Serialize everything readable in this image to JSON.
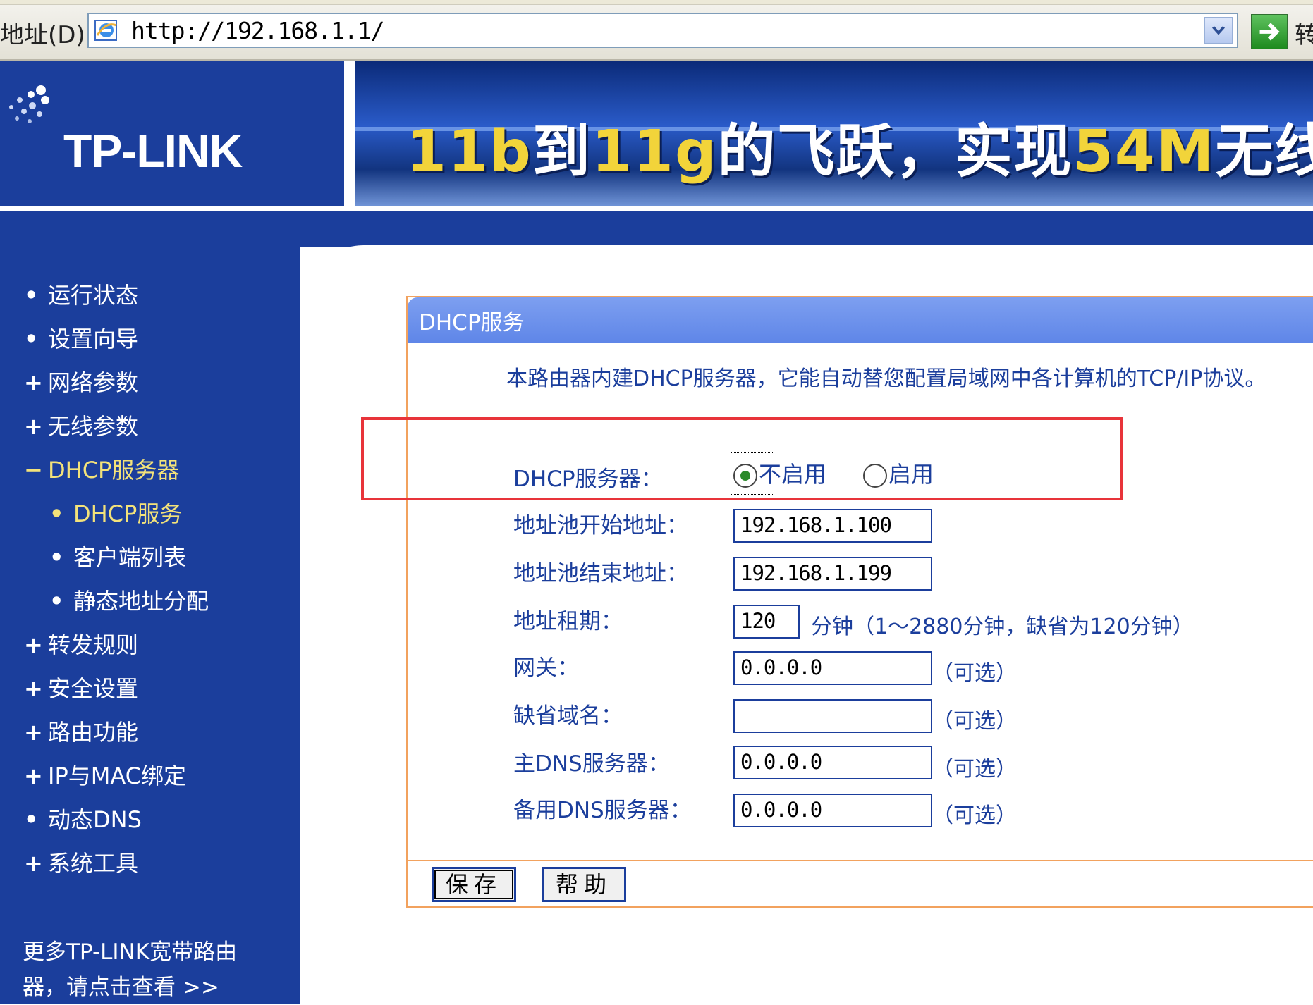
{
  "browser": {
    "address_label": "地址(D)",
    "url": "http://192.168.1.1/",
    "go_label": "转"
  },
  "banner": {
    "logo": "TP-LINK",
    "slogan_parts": [
      "11b",
      "到",
      "11g",
      "的飞跃，实现",
      "54M",
      "无线高"
    ]
  },
  "sidebar": {
    "items": [
      {
        "mark": "•",
        "label": "运行状态"
      },
      {
        "mark": "•",
        "label": "设置向导"
      },
      {
        "mark": "+",
        "label": "网络参数"
      },
      {
        "mark": "+",
        "label": "无线参数"
      },
      {
        "mark": "−",
        "label": "DHCP服务器"
      },
      {
        "mark": "•",
        "label": "DHCP服务"
      },
      {
        "mark": "•",
        "label": "客户端列表"
      },
      {
        "mark": "•",
        "label": "静态地址分配"
      },
      {
        "mark": "+",
        "label": "转发规则"
      },
      {
        "mark": "+",
        "label": "安全设置"
      },
      {
        "mark": "+",
        "label": "路由功能"
      },
      {
        "mark": "+",
        "label": "IP与MAC绑定"
      },
      {
        "mark": "•",
        "label": "动态DNS"
      },
      {
        "mark": "+",
        "label": "系统工具"
      }
    ],
    "more_link": "更多TP-LINK宽带路由器，请点击查看 >>"
  },
  "panel": {
    "title": "DHCP服务",
    "description": "本路由器内建DHCP服务器，它能自动替您配置局域网中各计算机的TCP/IP协议。",
    "dhcp_server_label": "DHCP服务器：",
    "radio_disable": "不启用",
    "radio_enable": "启用",
    "radio_selected": "不启用",
    "pool_start_label": "地址池开始地址：",
    "pool_start_value": "192.168.1.100",
    "pool_end_label": "地址池结束地址：",
    "pool_end_value": "192.168.1.199",
    "lease_label": "地址租期：",
    "lease_value": "120",
    "lease_note": "分钟（1～2880分钟，缺省为120分钟）",
    "gateway_label": "网关：",
    "gateway_value": "0.0.0.0",
    "domain_label": "缺省域名：",
    "domain_value": "",
    "dns1_label": "主DNS服务器：",
    "dns1_value": "0.0.0.0",
    "dns2_label": "备用DNS服务器：",
    "dns2_value": "0.0.0.0",
    "optional_note": "（可选）",
    "save_label": "保存",
    "help_label": "帮助"
  },
  "colors": {
    "nav_bg": "#1b3e9c",
    "panel_header": "#6f94ec",
    "panel_border": "#f2a25e",
    "highlight": "#e8343a",
    "active_nav": "#f3e27a"
  }
}
